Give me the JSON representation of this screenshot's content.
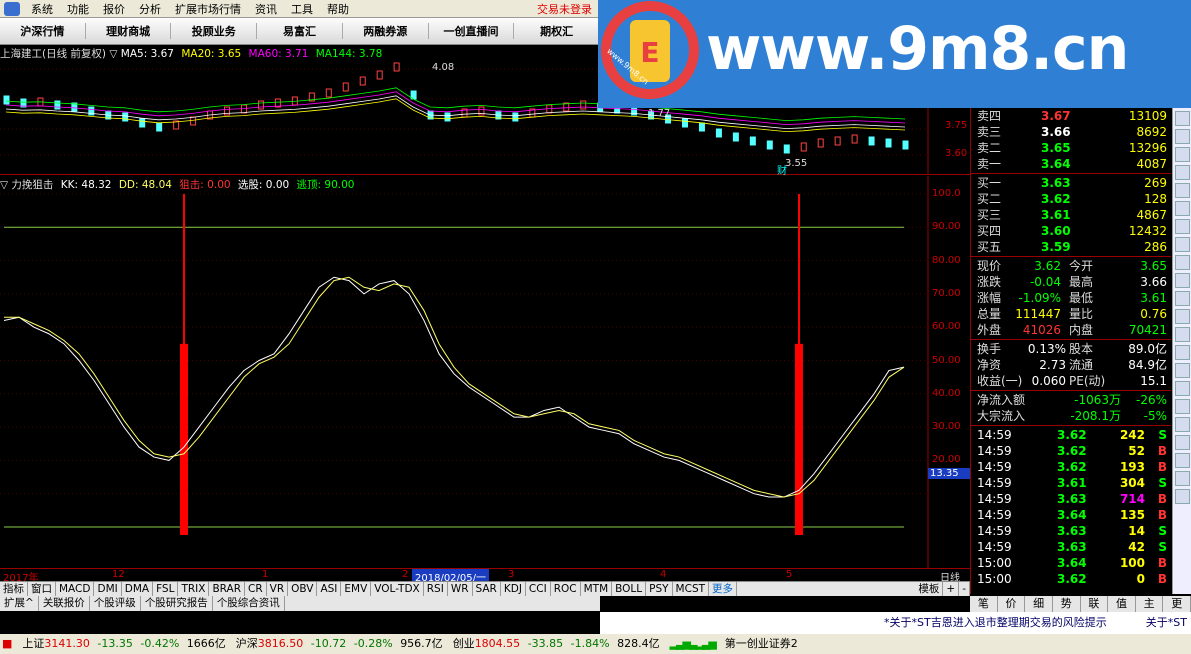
{
  "menu": {
    "items": [
      "系统",
      "功能",
      "报价",
      "分析",
      "扩展市场行情",
      "资讯",
      "工具",
      "帮助"
    ],
    "status": "交易未登录"
  },
  "tabs": [
    "沪深行情",
    "理财商城",
    "投顾业务",
    "易富汇",
    "两融券源",
    "一创直播间",
    "期权汇"
  ],
  "watermark": {
    "domain": "www.9m8.cn",
    "small": "www.9m8.cn"
  },
  "price_chart": {
    "title": "上海建工(日线 前复权)",
    "ma5": "MA5: 3.67",
    "ma20": "MA20: 3.65",
    "ma60": "MA60: 3.71",
    "ma144": "MA144: 3.78",
    "high_label": "4.08",
    "low_label": "3.55",
    "mid_label": "1.77",
    "cai": "财",
    "y_labels": [
      "3.75",
      "3.60"
    ]
  },
  "indicator": {
    "name": "力挽狙击",
    "kk": "KK: 48.32",
    "dd": "DD: 48.04",
    "snipe_label": "狙击:",
    "snipe_val": "0.00",
    "pick_label": "选股:",
    "pick_val": "0.00",
    "top_label": "逃顶:",
    "top_val": "90.00",
    "cursor_value": "13.35",
    "y_labels": [
      "100.0",
      "90.00",
      "80.00",
      "70.00",
      "60.00",
      "50.00",
      "40.00",
      "30.00",
      "20.00"
    ]
  },
  "time_axis": {
    "labels": [
      "2017年",
      "12",
      "1",
      "2",
      "3",
      "4",
      "5"
    ],
    "cursor_date": "2018/02/05/一",
    "period": "日线"
  },
  "indicator_tabs": [
    "指标",
    "窗口",
    "MACD",
    "DMI",
    "DMA",
    "FSL",
    "TRIX",
    "BRAR",
    "CR",
    "VR",
    "OBV",
    "ASI",
    "EMV",
    "VOL-TDX",
    "RSI",
    "WR",
    "SAR",
    "KDJ",
    "CCI",
    "ROC",
    "MTM",
    "BOLL",
    "PSY",
    "MCST"
  ],
  "indicator_more": "更多",
  "indicator_tail": [
    "模板",
    "+",
    "-"
  ],
  "ext_tabs": [
    "扩展^",
    "关联报价",
    "个股评级",
    "个股研究报告",
    "个股综合资讯"
  ],
  "orderbook": [
    {
      "label": "卖四",
      "price": "3.67",
      "vol": "13109",
      "pc": "r"
    },
    {
      "label": "卖三",
      "price": "3.66",
      "vol": "8692",
      "pc": "w"
    },
    {
      "label": "卖二",
      "price": "3.65",
      "vol": "13296",
      "pc": "g"
    },
    {
      "label": "卖一",
      "price": "3.64",
      "vol": "4087",
      "pc": "g"
    },
    {
      "label": "买一",
      "price": "3.63",
      "vol": "269",
      "pc": "g"
    },
    {
      "label": "买二",
      "price": "3.62",
      "vol": "128",
      "pc": "g"
    },
    {
      "label": "买三",
      "price": "3.61",
      "vol": "4867",
      "pc": "g"
    },
    {
      "label": "买四",
      "price": "3.60",
      "vol": "12432",
      "pc": "g"
    },
    {
      "label": "买五",
      "price": "3.59",
      "vol": "286",
      "pc": "g"
    }
  ],
  "quote": [
    {
      "l1": "现价",
      "v1": "3.62",
      "c1": "g",
      "l2": "今开",
      "v2": "3.65",
      "c2": "g"
    },
    {
      "l1": "涨跌",
      "v1": "-0.04",
      "c1": "g",
      "l2": "最高",
      "v2": "3.66",
      "c2": "w"
    },
    {
      "l1": "涨幅",
      "v1": "-1.09%",
      "c1": "g",
      "l2": "最低",
      "v2": "3.61",
      "c2": "g"
    },
    {
      "l1": "总量",
      "v1": "111447",
      "c1": "y",
      "l2": "量比",
      "v2": "0.76",
      "c2": "y"
    },
    {
      "l1": "外盘",
      "v1": "41026",
      "c1": "r",
      "l2": "内盘",
      "v2": "70421",
      "c2": "g"
    }
  ],
  "fundamentals": [
    {
      "l1": "换手",
      "v1": "0.13%",
      "l2": "股本",
      "v2": "89.0亿"
    },
    {
      "l1": "净资",
      "v1": "2.73",
      "l2": "流通",
      "v2": "84.9亿"
    },
    {
      "l1": "收益(一)",
      "v1": "0.060",
      "l2": "PE(动)",
      "v2": "15.1"
    }
  ],
  "flows": [
    {
      "label": "净流入额",
      "v1": "-1063万",
      "v2": "-26%"
    },
    {
      "label": "大宗流入",
      "v1": "-208.1万",
      "v2": "-5%"
    }
  ],
  "ticks": [
    {
      "t": "14:59",
      "p": "3.62",
      "v": "242",
      "s": "S",
      "vc": "y",
      "sc": "g"
    },
    {
      "t": "14:59",
      "p": "3.62",
      "v": "52",
      "s": "B",
      "vc": "y",
      "sc": "r"
    },
    {
      "t": "14:59",
      "p": "3.62",
      "v": "193",
      "s": "B",
      "vc": "y",
      "sc": "r"
    },
    {
      "t": "14:59",
      "p": "3.61",
      "v": "304",
      "s": "S",
      "vc": "y",
      "sc": "g"
    },
    {
      "t": "14:59",
      "p": "3.63",
      "v": "714",
      "s": "B",
      "vc": "m",
      "sc": "r"
    },
    {
      "t": "14:59",
      "p": "3.64",
      "v": "135",
      "s": "B",
      "vc": "y",
      "sc": "r"
    },
    {
      "t": "14:59",
      "p": "3.63",
      "v": "14",
      "s": "S",
      "vc": "y",
      "sc": "g"
    },
    {
      "t": "14:59",
      "p": "3.63",
      "v": "42",
      "s": "S",
      "vc": "y",
      "sc": "g"
    },
    {
      "t": "15:00",
      "p": "3.64",
      "v": "100",
      "s": "B",
      "vc": "y",
      "sc": "r"
    },
    {
      "t": "15:00",
      "p": "3.62",
      "v": "0",
      "s": "B",
      "vc": "y",
      "sc": "r"
    }
  ],
  "right_tabs": [
    "笔",
    "价",
    "细",
    "势",
    "联",
    "值",
    "主",
    "更"
  ],
  "news": "*关于*ST吉恩进入退市整理期交易的风险提示",
  "news_right": "关于*ST",
  "statusbar": [
    {
      "name": "上证",
      "v": "3141.30",
      "chg": "-13.35",
      "pct": "-0.42%",
      "amt": "1666亿"
    },
    {
      "name": "沪深",
      "v": "3816.50",
      "chg": "-10.72",
      "pct": "-0.28%",
      "amt": "956.7亿"
    },
    {
      "name": "创业",
      "v": "1804.55",
      "chg": "-33.85",
      "pct": "-1.84%",
      "amt": "828.4亿"
    }
  ],
  "broker": "第一创业证券2",
  "colors": {
    "up": "#ff3333",
    "down": "#00ff00",
    "kk": "#ffffff",
    "dd": "#ffff66",
    "band": "#88cc44",
    "spike": "#ff0000"
  },
  "chart_data": {
    "type": "line",
    "series": [
      {
        "name": "KK",
        "values": [
          62,
          63,
          60,
          58,
          55,
          50,
          44,
          37,
          30,
          24,
          21,
          20,
          24,
          30,
          36,
          42,
          47,
          50,
          52,
          58,
          65,
          72,
          75,
          74,
          70,
          73,
          74,
          70,
          62,
          52,
          46,
          42,
          39,
          36,
          33,
          33,
          35,
          36,
          33,
          30,
          29,
          28,
          25,
          23,
          21,
          20,
          18,
          16,
          14,
          12,
          10,
          9,
          9,
          11,
          16,
          22,
          28,
          34,
          40,
          47,
          48
        ]
      },
      {
        "name": "DD",
        "values": [
          63,
          63,
          61,
          59,
          56,
          52,
          46,
          39,
          32,
          26,
          22,
          21,
          22,
          27,
          33,
          39,
          45,
          49,
          51,
          55,
          62,
          69,
          74,
          75,
          72,
          71,
          73,
          72,
          65,
          55,
          48,
          43,
          40,
          37,
          34,
          33,
          34,
          35,
          34,
          31,
          30,
          29,
          26,
          24,
          22,
          21,
          19,
          17,
          15,
          13,
          11,
          10,
          9,
          10,
          14,
          20,
          26,
          32,
          38,
          45,
          48
        ]
      }
    ],
    "spikes": [
      {
        "x_index": 12,
        "value": 100
      },
      {
        "x_index": 53,
        "value": 100
      }
    ],
    "ylim": [
      0,
      100
    ],
    "levels": [
      90,
      0
    ]
  }
}
